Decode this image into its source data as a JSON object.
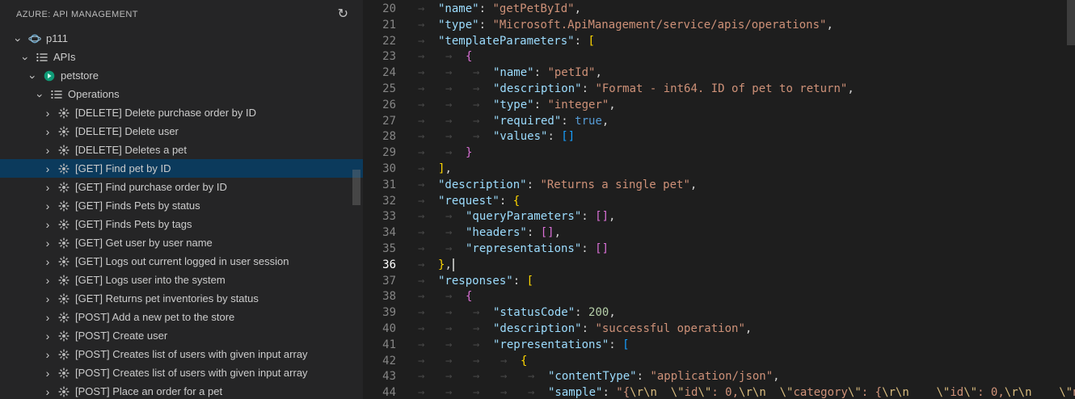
{
  "palette": {
    "editor_bg": "#1e1e1e",
    "sidebar_bg": "#252526",
    "selection_bg": "#0b3a5c",
    "text": "#cccccc",
    "key": "#9cdcfe",
    "string": "#ce9178",
    "escape": "#d7ba7d",
    "number": "#b5cea8",
    "keyword": "#569cd6",
    "punctuation": "#d4d4d4",
    "bracket1": "#ffd700",
    "bracket2": "#da70d6",
    "bracket3": "#179fff",
    "line_number": "#858585",
    "whitespace": "#464646"
  },
  "icons": {
    "refresh": "↻",
    "chevron": "›",
    "tab_arrow": "→"
  },
  "sidebar": {
    "header": {
      "title": "AZURE: API MANAGEMENT"
    },
    "tree": [
      {
        "label": "p111",
        "depth": 0,
        "expanded": true,
        "icon": "apim-service",
        "selected": false
      },
      {
        "label": "APIs",
        "depth": 1,
        "expanded": true,
        "icon": "list",
        "selected": false
      },
      {
        "label": "petstore",
        "depth": 2,
        "expanded": true,
        "icon": "api",
        "selected": false
      },
      {
        "label": "Operations",
        "depth": 3,
        "expanded": true,
        "icon": "list",
        "selected": false
      },
      {
        "label": "[DELETE] Delete purchase order by ID",
        "depth": 4,
        "expanded": false,
        "icon": "operation",
        "selected": false
      },
      {
        "label": "[DELETE] Delete user",
        "depth": 4,
        "expanded": false,
        "icon": "operation",
        "selected": false
      },
      {
        "label": "[DELETE] Deletes a pet",
        "depth": 4,
        "expanded": false,
        "icon": "operation",
        "selected": false
      },
      {
        "label": "[GET] Find pet by ID",
        "depth": 4,
        "expanded": false,
        "icon": "operation",
        "selected": true
      },
      {
        "label": "[GET] Find purchase order by ID",
        "depth": 4,
        "expanded": false,
        "icon": "operation",
        "selected": false
      },
      {
        "label": "[GET] Finds Pets by status",
        "depth": 4,
        "expanded": false,
        "icon": "operation",
        "selected": false
      },
      {
        "label": "[GET] Finds Pets by tags",
        "depth": 4,
        "expanded": false,
        "icon": "operation",
        "selected": false
      },
      {
        "label": "[GET] Get user by user name",
        "depth": 4,
        "expanded": false,
        "icon": "operation",
        "selected": false
      },
      {
        "label": "[GET] Logs out current logged in user session",
        "depth": 4,
        "expanded": false,
        "icon": "operation",
        "selected": false
      },
      {
        "label": "[GET] Logs user into the system",
        "depth": 4,
        "expanded": false,
        "icon": "operation",
        "selected": false
      },
      {
        "label": "[GET] Returns pet inventories by status",
        "depth": 4,
        "expanded": false,
        "icon": "operation",
        "selected": false
      },
      {
        "label": "[POST] Add a new pet to the store",
        "depth": 4,
        "expanded": false,
        "icon": "operation",
        "selected": false
      },
      {
        "label": "[POST] Create user",
        "depth": 4,
        "expanded": false,
        "icon": "operation",
        "selected": false
      },
      {
        "label": "[POST] Creates list of users with given input array",
        "depth": 4,
        "expanded": false,
        "icon": "operation",
        "selected": false
      },
      {
        "label": "[POST] Creates list of users with given input array",
        "depth": 4,
        "expanded": false,
        "icon": "operation",
        "selected": false
      },
      {
        "label": "[POST] Place an order for a pet",
        "depth": 4,
        "expanded": false,
        "icon": "operation",
        "selected": false
      }
    ]
  },
  "editor": {
    "language": "json",
    "active_line": 36,
    "lines": [
      {
        "num": 20,
        "indent": 1,
        "tokens": [
          [
            "k",
            "\"name\""
          ],
          [
            "p",
            ": "
          ],
          [
            "s",
            "\"getPetById\""
          ],
          [
            "p",
            ","
          ]
        ]
      },
      {
        "num": 21,
        "indent": 1,
        "tokens": [
          [
            "k",
            "\"type\""
          ],
          [
            "p",
            ": "
          ],
          [
            "s",
            "\"Microsoft.ApiManagement/service/apis/operations\""
          ],
          [
            "p",
            ","
          ]
        ]
      },
      {
        "num": 22,
        "indent": 1,
        "tokens": [
          [
            "k",
            "\"templateParameters\""
          ],
          [
            "p",
            ": "
          ],
          [
            "1",
            "["
          ]
        ]
      },
      {
        "num": 23,
        "indent": 2,
        "tokens": [
          [
            "2",
            "{"
          ]
        ]
      },
      {
        "num": 24,
        "indent": 3,
        "tokens": [
          [
            "k",
            "\"name\""
          ],
          [
            "p",
            ": "
          ],
          [
            "s",
            "\"petId\""
          ],
          [
            "p",
            ","
          ]
        ]
      },
      {
        "num": 25,
        "indent": 3,
        "tokens": [
          [
            "k",
            "\"description\""
          ],
          [
            "p",
            ": "
          ],
          [
            "s",
            "\"Format - int64. ID of pet to return\""
          ],
          [
            "p",
            ","
          ]
        ]
      },
      {
        "num": 26,
        "indent": 3,
        "tokens": [
          [
            "k",
            "\"type\""
          ],
          [
            "p",
            ": "
          ],
          [
            "s",
            "\"integer\""
          ],
          [
            "p",
            ","
          ]
        ]
      },
      {
        "num": 27,
        "indent": 3,
        "tokens": [
          [
            "k",
            "\"required\""
          ],
          [
            "p",
            ": "
          ],
          [
            "w",
            "true"
          ],
          [
            "p",
            ","
          ]
        ]
      },
      {
        "num": 28,
        "indent": 3,
        "tokens": [
          [
            "k",
            "\"values\""
          ],
          [
            "p",
            ": "
          ],
          [
            "3",
            "[]"
          ]
        ]
      },
      {
        "num": 29,
        "indent": 2,
        "tokens": [
          [
            "2",
            "}"
          ]
        ]
      },
      {
        "num": 30,
        "indent": 1,
        "tokens": [
          [
            "1",
            "]"
          ],
          [
            "p",
            ","
          ]
        ]
      },
      {
        "num": 31,
        "indent": 1,
        "tokens": [
          [
            "k",
            "\"description\""
          ],
          [
            "p",
            ": "
          ],
          [
            "s",
            "\"Returns a single pet\""
          ],
          [
            "p",
            ","
          ]
        ]
      },
      {
        "num": 32,
        "indent": 1,
        "tokens": [
          [
            "k",
            "\"request\""
          ],
          [
            "p",
            ": "
          ],
          [
            "1",
            "{"
          ]
        ]
      },
      {
        "num": 33,
        "indent": 2,
        "tokens": [
          [
            "k",
            "\"queryParameters\""
          ],
          [
            "p",
            ": "
          ],
          [
            "2",
            "[]"
          ],
          [
            "p",
            ","
          ]
        ]
      },
      {
        "num": 34,
        "indent": 2,
        "tokens": [
          [
            "k",
            "\"headers\""
          ],
          [
            "p",
            ": "
          ],
          [
            "2",
            "[]"
          ],
          [
            "p",
            ","
          ]
        ]
      },
      {
        "num": 35,
        "indent": 2,
        "tokens": [
          [
            "k",
            "\"representations\""
          ],
          [
            "p",
            ": "
          ],
          [
            "2",
            "[]"
          ]
        ]
      },
      {
        "num": 36,
        "indent": 1,
        "tokens": [
          [
            "1",
            "}"
          ],
          [
            "p",
            ","
          ]
        ]
      },
      {
        "num": 37,
        "indent": 1,
        "tokens": [
          [
            "k",
            "\"responses\""
          ],
          [
            "p",
            ": "
          ],
          [
            "1",
            "["
          ]
        ]
      },
      {
        "num": 38,
        "indent": 2,
        "tokens": [
          [
            "2",
            "{"
          ]
        ]
      },
      {
        "num": 39,
        "indent": 3,
        "tokens": [
          [
            "k",
            "\"statusCode\""
          ],
          [
            "p",
            ": "
          ],
          [
            "n",
            "200"
          ],
          [
            "p",
            ","
          ]
        ]
      },
      {
        "num": 40,
        "indent": 3,
        "tokens": [
          [
            "k",
            "\"description\""
          ],
          [
            "p",
            ": "
          ],
          [
            "s",
            "\"successful operation\""
          ],
          [
            "p",
            ","
          ]
        ]
      },
      {
        "num": 41,
        "indent": 3,
        "tokens": [
          [
            "k",
            "\"representations\""
          ],
          [
            "p",
            ": "
          ],
          [
            "3",
            "["
          ]
        ]
      },
      {
        "num": 42,
        "indent": 4,
        "tokens": [
          [
            "1",
            "{"
          ]
        ]
      },
      {
        "num": 43,
        "indent": 5,
        "tokens": [
          [
            "k",
            "\"contentType\""
          ],
          [
            "p",
            ": "
          ],
          [
            "s",
            "\"application/json\""
          ],
          [
            "p",
            ","
          ]
        ]
      },
      {
        "num": 44,
        "indent": 5,
        "tokens": [
          [
            "k",
            "\"sample\""
          ],
          [
            "p",
            ": "
          ],
          [
            "s",
            "\"{"
          ],
          [
            "e",
            "\\r\\n"
          ],
          [
            "s",
            "  "
          ],
          [
            "e",
            "\\\""
          ],
          [
            "s",
            "id"
          ],
          [
            "e",
            "\\\""
          ],
          [
            "s",
            ": 0,"
          ],
          [
            "e",
            "\\r\\n"
          ],
          [
            "s",
            "  "
          ],
          [
            "e",
            "\\\""
          ],
          [
            "s",
            "category"
          ],
          [
            "e",
            "\\\""
          ],
          [
            "s",
            ": {"
          ],
          [
            "e",
            "\\r\\n"
          ],
          [
            "s",
            "    "
          ],
          [
            "e",
            "\\\""
          ],
          [
            "s",
            "id"
          ],
          [
            "e",
            "\\\""
          ],
          [
            "s",
            ": 0,"
          ],
          [
            "e",
            "\\r\\n"
          ],
          [
            "s",
            "    "
          ],
          [
            "e",
            "\\\""
          ],
          [
            "s",
            "name"
          ]
        ]
      }
    ]
  }
}
